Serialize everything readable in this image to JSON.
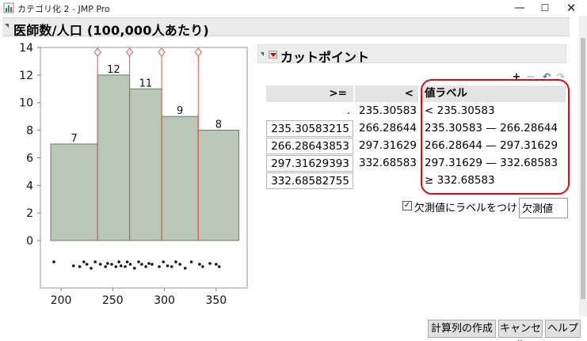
{
  "window": {
    "title": "カテゴリ化 2 - JMP Pro",
    "minimize_glyph": "—",
    "maximize_glyph": "☐",
    "close_glyph": "✕"
  },
  "report": {
    "title": "医師数/人口 (100,000人あたり)"
  },
  "cutpoints_panel": {
    "title": "カットポイント",
    "toolbar": {
      "add_icon": "+",
      "remove_icon": "−",
      "undo_icon": "↶",
      "redo_icon": "↷"
    },
    "columns": [
      ">=",
      "<",
      "値ラベル"
    ],
    "rows": [
      {
        "ge": ".",
        "lt": "235.30583",
        "label": "< 235.30583"
      },
      {
        "ge": "235.30583215",
        "lt": "266.28644",
        "label": "235.30583 — 266.28644"
      },
      {
        "ge": "266.28643853",
        "lt": "297.31629",
        "label": "266.28644 — 297.31629"
      },
      {
        "ge": "297.31629393",
        "lt": "332.68583",
        "label": "297.31629 — 332.68583"
      },
      {
        "ge": "332.68582755",
        "lt": "",
        "label": "≥ 332.68583"
      }
    ],
    "missing_checkbox": {
      "checked": true,
      "mark": "✓",
      "label": "欠測値にラベルをつける",
      "value": "欠測値"
    }
  },
  "buttons": {
    "make_column": "計算列の作成",
    "cancel": "キャンセル",
    "help": "ヘルプ"
  },
  "chart_data": {
    "type": "bar",
    "title": "",
    "categories": [
      "< 235.30583",
      "235.30583 — 266.28644",
      "266.28644 — 297.31629",
      "297.31629 — 332.68583",
      "≥ 332.68583"
    ],
    "bins": [
      [
        190,
        235.30583
      ],
      [
        235.30583,
        266.28644
      ],
      [
        266.28644,
        297.31629
      ],
      [
        297.31629,
        332.68583
      ],
      [
        332.68583,
        372
      ]
    ],
    "values": [
      7,
      12,
      11,
      9,
      8
    ],
    "cutpoints": [
      235.30583,
      266.28644,
      297.31629,
      332.68583
    ],
    "yticks": [
      0,
      2,
      4,
      6,
      8,
      10,
      12,
      14
    ],
    "xticks": [
      200,
      250,
      300,
      350
    ],
    "ylim": [
      0,
      14
    ],
    "xlim": [
      180,
      380
    ],
    "bar_color": "#b8c8b4",
    "cut_color": "#e05050",
    "rug_points": [
      193,
      212,
      218,
      222,
      225,
      229,
      233,
      238,
      243,
      245,
      249,
      253,
      256,
      258,
      262,
      264,
      267,
      271,
      275,
      278,
      282,
      285,
      288,
      295,
      299,
      303,
      307,
      311,
      315,
      320,
      326,
      334,
      337,
      344,
      350,
      353
    ]
  }
}
